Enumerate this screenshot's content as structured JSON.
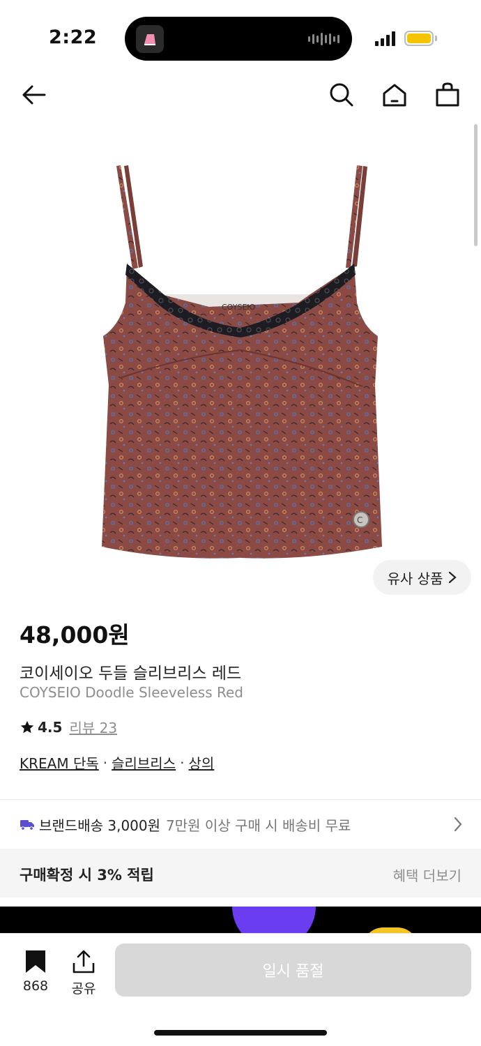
{
  "status_bar": {
    "time": "2:22"
  },
  "nav": {
    "back_icon": "arrow-left-icon",
    "search_icon": "search-icon",
    "home_icon": "home-icon",
    "cart_icon": "shopping-bag-icon"
  },
  "product": {
    "image_description_icon": "camisole-image",
    "similar_button": "유사 상품",
    "price": "48,000원",
    "name_ko": "코이세이오 두들 슬리브리스 레드",
    "name_en": "COYSEIO Doodle Sleeveless Red",
    "rating": "4.5",
    "review_label": "리뷰 23",
    "tags": [
      "KREAM 단독",
      "슬리브리스",
      "상의"
    ],
    "colors": {
      "fabric": "#8b4a43",
      "lace": "#1c1c22"
    }
  },
  "shipping": {
    "main": "브랜드배송 3,000원",
    "sub": "7만원 이상 구매 시 배송비 무료",
    "icon_color": "#5b4fcf"
  },
  "benefit": {
    "title": "구매확정 시 3% 적립",
    "more": "혜택 더보기"
  },
  "bottom_bar": {
    "bookmark_count": "868",
    "share_label": "공유",
    "buy_button": "일시 품절"
  }
}
